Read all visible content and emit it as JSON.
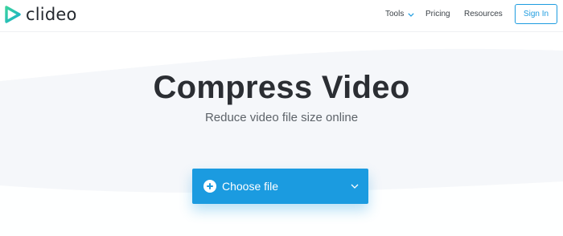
{
  "brand": {
    "name": "clideo"
  },
  "nav": {
    "tools_label": "Tools",
    "pricing_label": "Pricing",
    "resources_label": "Resources",
    "signin_label": "Sign In"
  },
  "hero": {
    "title": "Compress Video",
    "subtitle": "Reduce video file size online"
  },
  "upload": {
    "button_label": "Choose file",
    "icon": "plus-circle-icon",
    "dropdown_icon": "chevron-down-icon"
  },
  "colors": {
    "accent": "#1b9be0",
    "logo_green": "#2bc48a",
    "title_text": "#2b2e33",
    "hero_tint": "#f4f6fa"
  }
}
